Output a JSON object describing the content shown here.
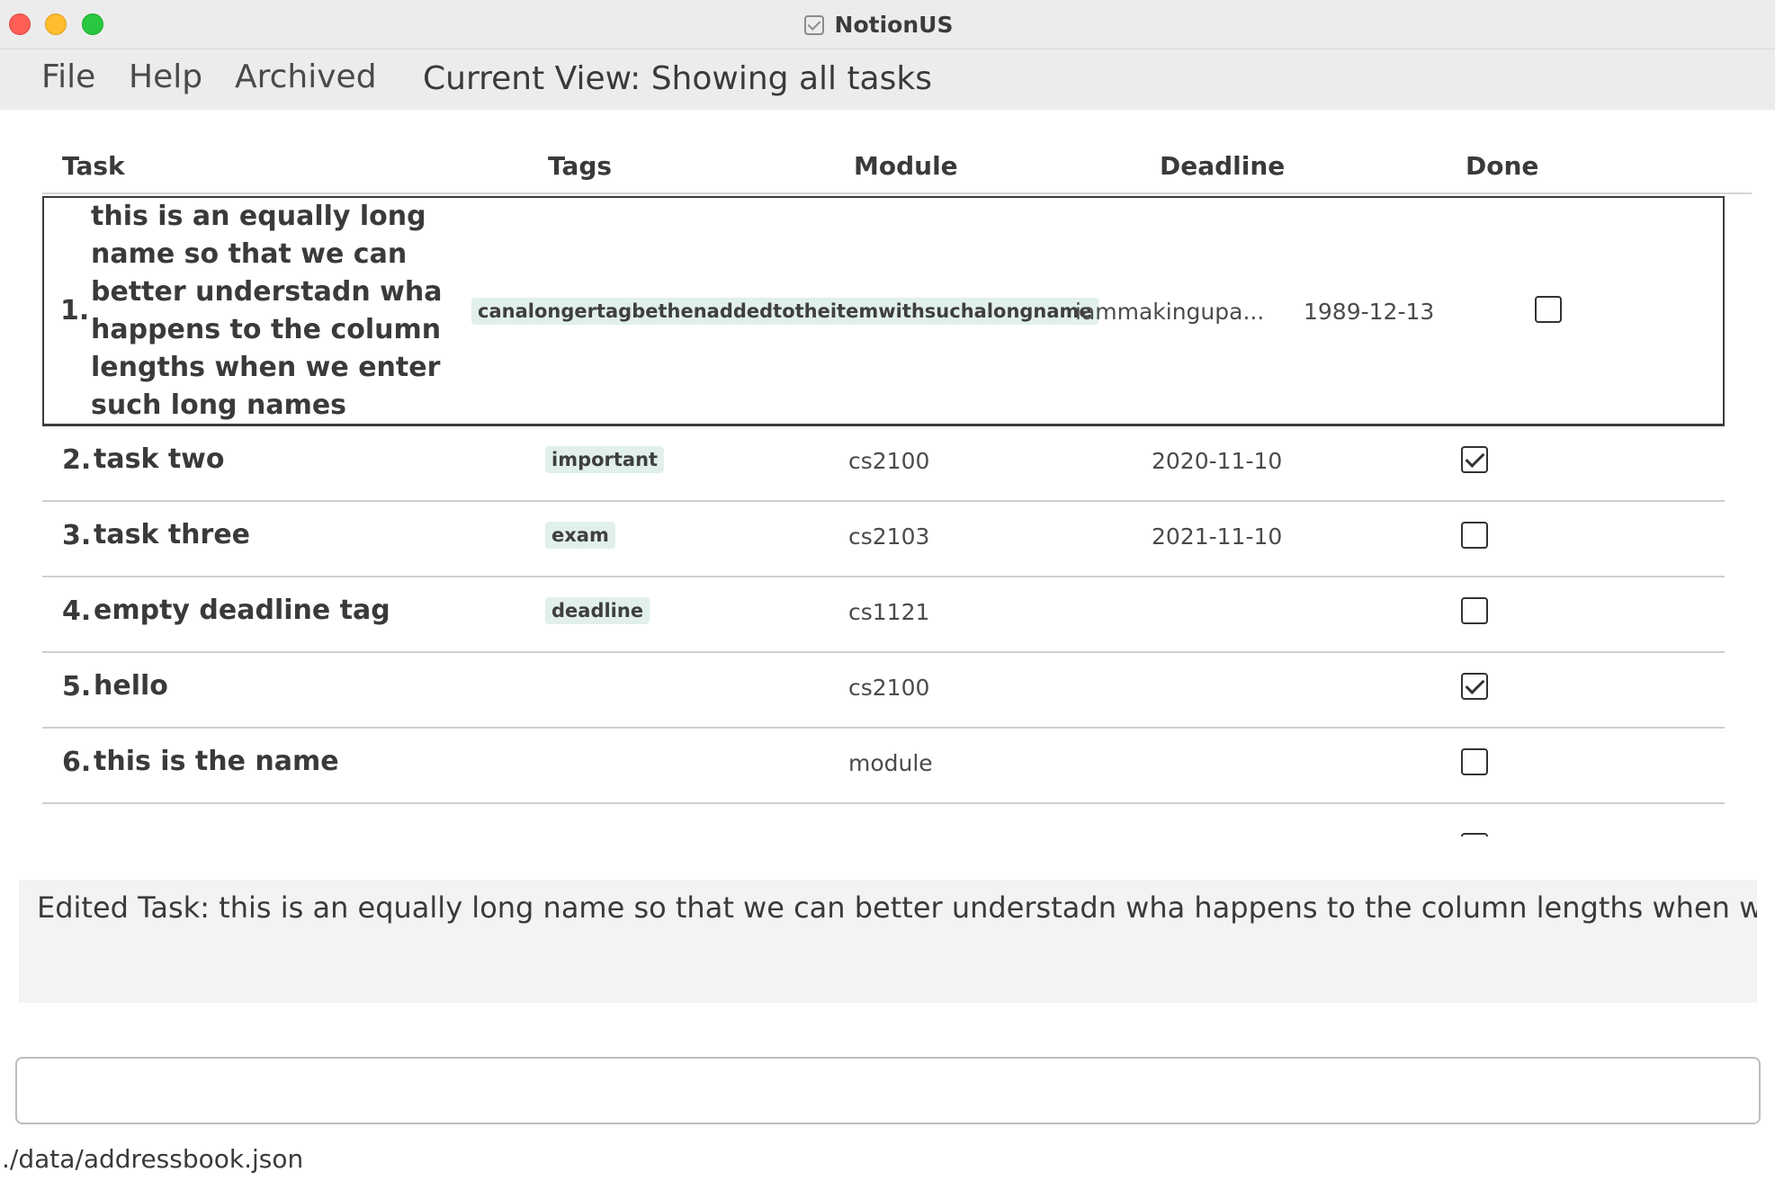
{
  "window": {
    "title": "NotionUS",
    "app_icon": "checkbox-icon"
  },
  "menu": {
    "file": "File",
    "help": "Help",
    "archived": "Archived",
    "current_view": "Current View: Showing all tasks"
  },
  "table": {
    "headers": {
      "task": "Task",
      "tags": "Tags",
      "module": "Module",
      "deadline": "Deadline",
      "done": "Done"
    },
    "rows": [
      {
        "index": "1.",
        "name": "this is an equally long\nname so that we can\nbetter understadn wha\nhappens to the column\nlengths when we enter\nsuch long names",
        "tag": "canalongertagbethenaddedtotheitemwithsuchalongname",
        "module": "iammakingupa...",
        "deadline": "1989-12-13",
        "done": false
      },
      {
        "index": "2.",
        "name": "task two",
        "tag": "important",
        "module": "cs2100",
        "deadline": "2020-11-10",
        "done": true
      },
      {
        "index": "3.",
        "name": "task three",
        "tag": "exam",
        "module": "cs2103",
        "deadline": "2021-11-10",
        "done": false
      },
      {
        "index": "4.",
        "name": "empty deadline tag",
        "tag": "deadline",
        "module": "cs1121",
        "deadline": "",
        "done": false
      },
      {
        "index": "5.",
        "name": "hello",
        "tag": "",
        "module": "cs2100",
        "deadline": "",
        "done": true
      },
      {
        "index": "6.",
        "name": "this is the name",
        "tag": "",
        "module": "module",
        "deadline": "",
        "done": false
      }
    ]
  },
  "result": {
    "text": "Edited Task: this is an equally long name so that we can better understadn wha happens to the column lengths when we enter such long names"
  },
  "command_box": {
    "value": "",
    "placeholder": ""
  },
  "status": {
    "path": "./data/addressbook.json"
  },
  "colors": {
    "tag_background": "#e1f0ea",
    "menubar": "#ececec",
    "result_background": "#f3f3f3"
  }
}
